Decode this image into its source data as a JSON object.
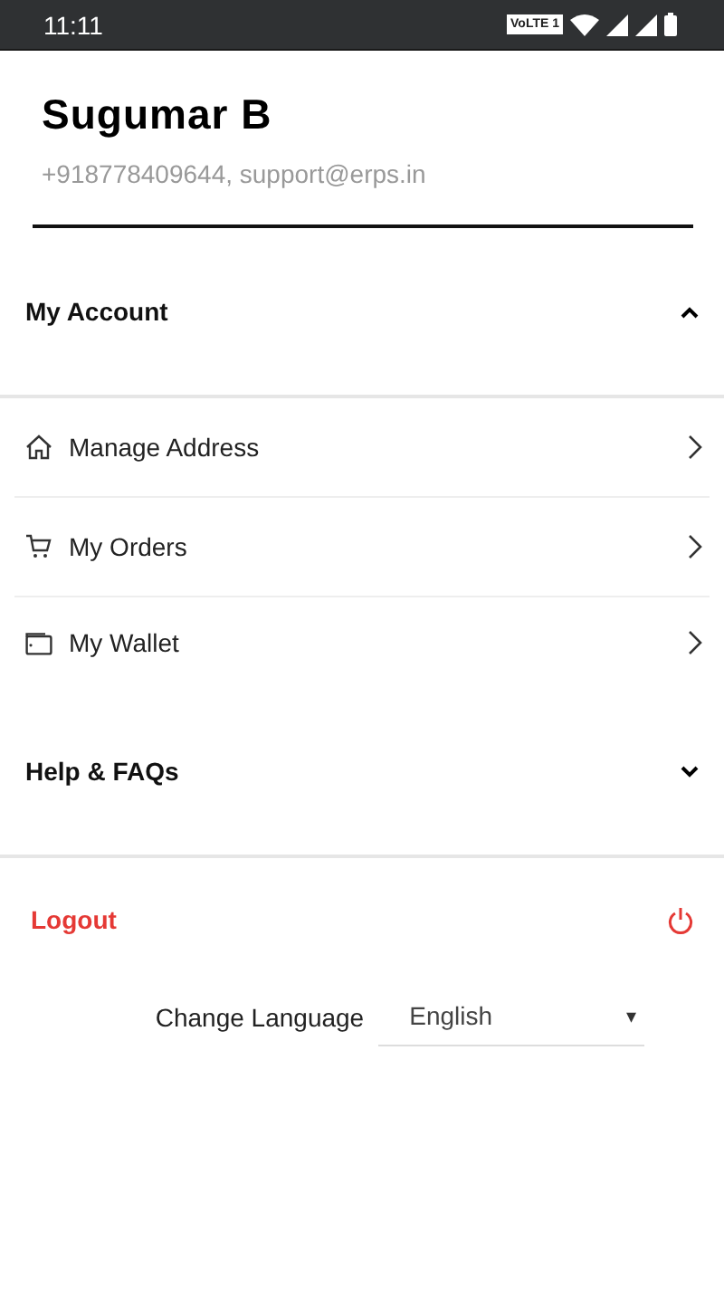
{
  "status_bar": {
    "time": "11:11",
    "network_badge": "VoLTE 1"
  },
  "profile": {
    "name": "Sugumar B",
    "contact": "+918778409644, support@erps.in"
  },
  "sections": [
    {
      "title": "My Account",
      "expanded": true,
      "items": [
        {
          "label": "Manage Address",
          "kind": "home"
        },
        {
          "label": "My Orders",
          "kind": "cart"
        },
        {
          "label": "My Wallet",
          "kind": "wallet"
        }
      ]
    },
    {
      "title": "Help & FAQs",
      "expanded": false
    }
  ],
  "logout": {
    "label": "Logout"
  },
  "language": {
    "label": "Change Language",
    "value": "English",
    "arrow": "▾"
  }
}
